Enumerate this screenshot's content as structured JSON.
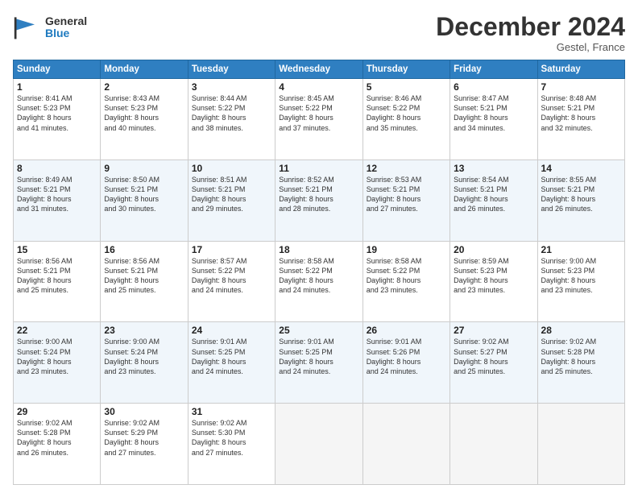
{
  "header": {
    "logo_general": "General",
    "logo_blue": "Blue",
    "month_title": "December 2024",
    "location": "Gestel, France"
  },
  "weekdays": [
    "Sunday",
    "Monday",
    "Tuesday",
    "Wednesday",
    "Thursday",
    "Friday",
    "Saturday"
  ],
  "weeks": [
    [
      {
        "day": "1",
        "info": "Sunrise: 8:41 AM\nSunset: 5:23 PM\nDaylight: 8 hours\nand 41 minutes."
      },
      {
        "day": "2",
        "info": "Sunrise: 8:43 AM\nSunset: 5:23 PM\nDaylight: 8 hours\nand 40 minutes."
      },
      {
        "day": "3",
        "info": "Sunrise: 8:44 AM\nSunset: 5:22 PM\nDaylight: 8 hours\nand 38 minutes."
      },
      {
        "day": "4",
        "info": "Sunrise: 8:45 AM\nSunset: 5:22 PM\nDaylight: 8 hours\nand 37 minutes."
      },
      {
        "day": "5",
        "info": "Sunrise: 8:46 AM\nSunset: 5:22 PM\nDaylight: 8 hours\nand 35 minutes."
      },
      {
        "day": "6",
        "info": "Sunrise: 8:47 AM\nSunset: 5:21 PM\nDaylight: 8 hours\nand 34 minutes."
      },
      {
        "day": "7",
        "info": "Sunrise: 8:48 AM\nSunset: 5:21 PM\nDaylight: 8 hours\nand 32 minutes."
      }
    ],
    [
      {
        "day": "8",
        "info": "Sunrise: 8:49 AM\nSunset: 5:21 PM\nDaylight: 8 hours\nand 31 minutes."
      },
      {
        "day": "9",
        "info": "Sunrise: 8:50 AM\nSunset: 5:21 PM\nDaylight: 8 hours\nand 30 minutes."
      },
      {
        "day": "10",
        "info": "Sunrise: 8:51 AM\nSunset: 5:21 PM\nDaylight: 8 hours\nand 29 minutes."
      },
      {
        "day": "11",
        "info": "Sunrise: 8:52 AM\nSunset: 5:21 PM\nDaylight: 8 hours\nand 28 minutes."
      },
      {
        "day": "12",
        "info": "Sunrise: 8:53 AM\nSunset: 5:21 PM\nDaylight: 8 hours\nand 27 minutes."
      },
      {
        "day": "13",
        "info": "Sunrise: 8:54 AM\nSunset: 5:21 PM\nDaylight: 8 hours\nand 26 minutes."
      },
      {
        "day": "14",
        "info": "Sunrise: 8:55 AM\nSunset: 5:21 PM\nDaylight: 8 hours\nand 26 minutes."
      }
    ],
    [
      {
        "day": "15",
        "info": "Sunrise: 8:56 AM\nSunset: 5:21 PM\nDaylight: 8 hours\nand 25 minutes."
      },
      {
        "day": "16",
        "info": "Sunrise: 8:56 AM\nSunset: 5:21 PM\nDaylight: 8 hours\nand 25 minutes."
      },
      {
        "day": "17",
        "info": "Sunrise: 8:57 AM\nSunset: 5:22 PM\nDaylight: 8 hours\nand 24 minutes."
      },
      {
        "day": "18",
        "info": "Sunrise: 8:58 AM\nSunset: 5:22 PM\nDaylight: 8 hours\nand 24 minutes."
      },
      {
        "day": "19",
        "info": "Sunrise: 8:58 AM\nSunset: 5:22 PM\nDaylight: 8 hours\nand 23 minutes."
      },
      {
        "day": "20",
        "info": "Sunrise: 8:59 AM\nSunset: 5:23 PM\nDaylight: 8 hours\nand 23 minutes."
      },
      {
        "day": "21",
        "info": "Sunrise: 9:00 AM\nSunset: 5:23 PM\nDaylight: 8 hours\nand 23 minutes."
      }
    ],
    [
      {
        "day": "22",
        "info": "Sunrise: 9:00 AM\nSunset: 5:24 PM\nDaylight: 8 hours\nand 23 minutes."
      },
      {
        "day": "23",
        "info": "Sunrise: 9:00 AM\nSunset: 5:24 PM\nDaylight: 8 hours\nand 23 minutes."
      },
      {
        "day": "24",
        "info": "Sunrise: 9:01 AM\nSunset: 5:25 PM\nDaylight: 8 hours\nand 24 minutes."
      },
      {
        "day": "25",
        "info": "Sunrise: 9:01 AM\nSunset: 5:25 PM\nDaylight: 8 hours\nand 24 minutes."
      },
      {
        "day": "26",
        "info": "Sunrise: 9:01 AM\nSunset: 5:26 PM\nDaylight: 8 hours\nand 24 minutes."
      },
      {
        "day": "27",
        "info": "Sunrise: 9:02 AM\nSunset: 5:27 PM\nDaylight: 8 hours\nand 25 minutes."
      },
      {
        "day": "28",
        "info": "Sunrise: 9:02 AM\nSunset: 5:28 PM\nDaylight: 8 hours\nand 25 minutes."
      }
    ],
    [
      {
        "day": "29",
        "info": "Sunrise: 9:02 AM\nSunset: 5:28 PM\nDaylight: 8 hours\nand 26 minutes."
      },
      {
        "day": "30",
        "info": "Sunrise: 9:02 AM\nSunset: 5:29 PM\nDaylight: 8 hours\nand 27 minutes."
      },
      {
        "day": "31",
        "info": "Sunrise: 9:02 AM\nSunset: 5:30 PM\nDaylight: 8 hours\nand 27 minutes."
      },
      {
        "day": "",
        "info": ""
      },
      {
        "day": "",
        "info": ""
      },
      {
        "day": "",
        "info": ""
      },
      {
        "day": "",
        "info": ""
      }
    ]
  ]
}
